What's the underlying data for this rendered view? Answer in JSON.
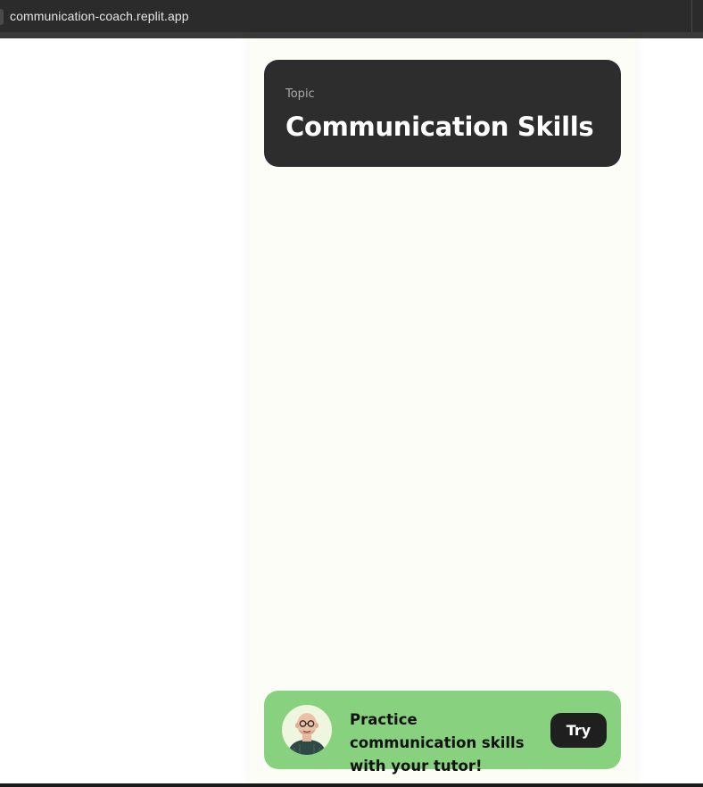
{
  "browser": {
    "url": "communication-coach.replit.app"
  },
  "topic": {
    "label": "Topic",
    "title": "Communication Skills"
  },
  "tutor_banner": {
    "message": "Practice communication skills with your tutor!",
    "button_label": "Try",
    "avatar_icon": "tutor-avatar"
  },
  "colors": {
    "panel_background": "#fbfdf6",
    "topic_card": "#2d2d2d",
    "banner": "#88d17e",
    "button": "#1f1f1f"
  }
}
